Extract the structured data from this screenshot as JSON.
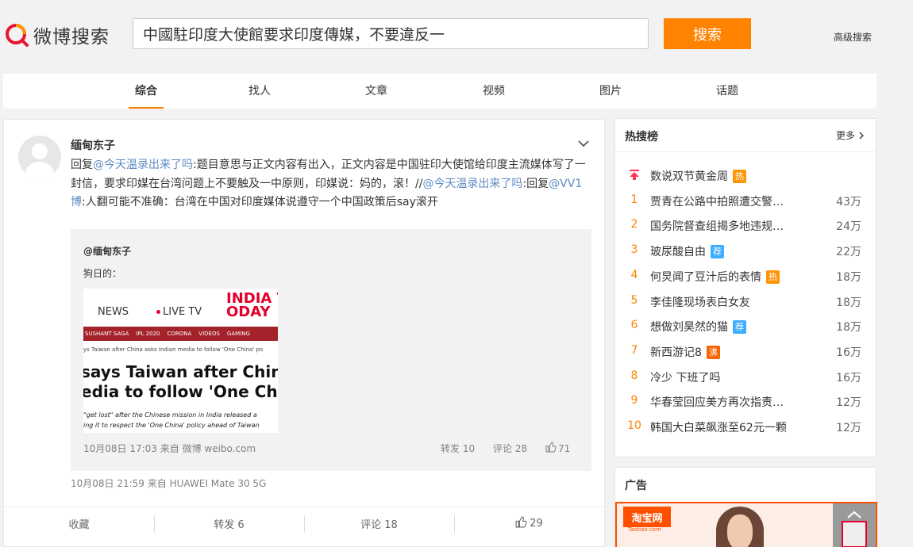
{
  "header": {
    "logo_text": "微博搜索",
    "search_value": "中國駐印度大使館要求印度傳媒，不要違反一",
    "search_button": "搜索",
    "advanced": "高级搜索"
  },
  "tabs": [
    {
      "label": "综合",
      "active": true
    },
    {
      "label": "找人"
    },
    {
      "label": "文章"
    },
    {
      "label": "视频"
    },
    {
      "label": "图片"
    },
    {
      "label": "话题"
    }
  ],
  "post": {
    "username": "缅甸东子",
    "text": {
      "p1": "回复",
      "at1": "@今天温录出来了吗",
      "p2": ":题目意思与正文内容有出入，正文内容是中国驻印大使馆给印度主流媒体写了一封信，要求印媒在台湾问题上不要触及一中原则，印媒说：妈的，滚！//",
      "at2": "@今天温录出来了吗",
      "p3": ":回复",
      "at3": "@VV1博",
      "p4": ":人翻可能不准确：台湾在中国对印度媒体说遵守一个中国政策后say滚开"
    },
    "repost": {
      "user": "@缅甸东子",
      "text": "狗日的：",
      "thumb": {
        "news": "NEWS",
        "live": "LIVE TV",
        "brand": "INDIA TODAY",
        "nav": [
          "SUSHANT SAGA",
          "IPL 2020",
          "CORONA",
          "VIDEOS",
          "GAMING"
        ],
        "crumb": "ys Taiwan after China asks Indian media to follow 'One China' po",
        "headline1": "says Taiwan after China as",
        "headline2": "edia to follow 'One China'",
        "sub1": "\"get lost\" after the Chinese mission in India released a",
        "sub2": "ing it to respect the 'One China' policy ahead of Taiwan"
      },
      "meta": "10月08日 17:03 来自 微博 weibo.com",
      "repost_count": "转发 10",
      "comment_count": "评论 28",
      "like_count": "71"
    },
    "meta": "10月08日 21:59  来自 HUAWEI Mate 30 5G",
    "actions": {
      "favorite": "收藏",
      "repost": "转发 6",
      "comment": "评论 18",
      "like": "29"
    }
  },
  "hot_search": {
    "title": "热搜榜",
    "more": "更多",
    "items": [
      {
        "rank": "",
        "word": "数说双节黄金周",
        "badge": "热",
        "count": ""
      },
      {
        "rank": "1",
        "word": "贾青在公路中拍照遭交警…",
        "count": "43万"
      },
      {
        "rank": "2",
        "word": "国务院督查组揭多地违规…",
        "count": "24万"
      },
      {
        "rank": "3",
        "word": "玻尿酸自由",
        "badge": "荐",
        "count": "22万"
      },
      {
        "rank": "4",
        "word": "何炅闻了豆汁后的表情",
        "badge": "热",
        "count": "18万"
      },
      {
        "rank": "5",
        "word": "李佳隆现场表白女友",
        "count": "18万"
      },
      {
        "rank": "6",
        "word": "想做刘昊然的猫",
        "badge": "荐",
        "count": "18万"
      },
      {
        "rank": "7",
        "word": "新西游记8",
        "badge": "沸",
        "count": "16万"
      },
      {
        "rank": "8",
        "word": "冷少 下班了吗",
        "count": "16万"
      },
      {
        "rank": "9",
        "word": "华春莹回应美方再次指责…",
        "count": "12万"
      },
      {
        "rank": "10",
        "word": "韩国大白菜飙涨至62元一颗",
        "count": "12万"
      }
    ],
    "colors": {
      "热": "#ff9406",
      "荐": "#3dadff",
      "沸": "#f86400"
    }
  },
  "ad": {
    "title": "广告",
    "brand": "淘宝网",
    "brand_sub": "Taobao.com"
  }
}
